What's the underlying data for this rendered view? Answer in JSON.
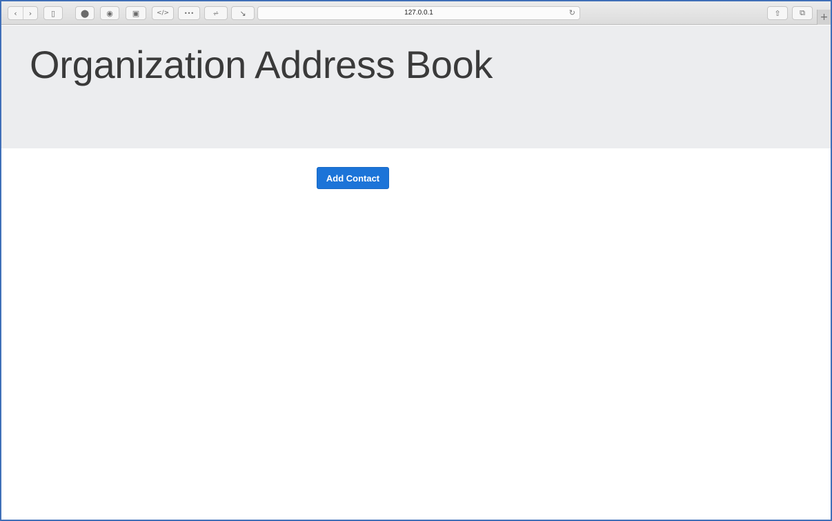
{
  "browser": {
    "url": "127.0.0.1",
    "buttons": [
      {
        "name": "back-icon",
        "glyph": "‹"
      },
      {
        "name": "forward-icon",
        "glyph": "›"
      },
      {
        "name": "sidebar-icon",
        "glyph": "▯"
      },
      {
        "name": "stop-icon",
        "glyph": "⬤"
      },
      {
        "name": "info-icon",
        "glyph": "◉"
      },
      {
        "name": "screenshot-icon",
        "glyph": "▣"
      },
      {
        "name": "code-icon",
        "glyph": "</>"
      },
      {
        "name": "more-icon",
        "glyph": "•••"
      },
      {
        "name": "network-icon",
        "glyph": "⩫"
      },
      {
        "name": "arrow-icon",
        "glyph": "↘"
      },
      {
        "name": "share-icon",
        "glyph": "⇧"
      },
      {
        "name": "tabs-icon",
        "glyph": "⧉"
      }
    ],
    "reload_glyph": "↻",
    "new_tab_glyph": "+"
  },
  "page": {
    "title": "Organization Address Book",
    "add_contact_label": "Add Contact"
  }
}
